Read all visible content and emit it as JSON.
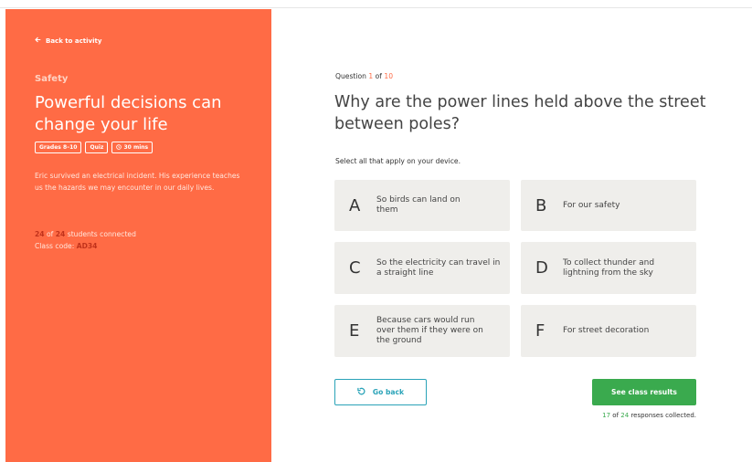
{
  "sidebar": {
    "back_label": "Back to activity",
    "category": "Safety",
    "title": "Powerful decisions can change your life",
    "tags": [
      "Grades 8–10",
      "Quiz",
      "30 mins"
    ],
    "description": "Eric survived an electrical incident. His experience teaches us the hazards we may encounter in our daily lives.",
    "connected_count": "24",
    "connected_of": "of",
    "connected_total": "24",
    "connected_suffix": "students connected",
    "class_code_label": "Class code:",
    "class_code": "AD34"
  },
  "question": {
    "prefix": "Question",
    "number": "1",
    "of": "of",
    "total": "10",
    "text": "Why are the power lines held above the street between poles?",
    "instruction": "Select all that apply on your device.",
    "options": [
      {
        "letter": "A",
        "text": "So birds can land on them"
      },
      {
        "letter": "B",
        "text": "For our safety"
      },
      {
        "letter": "C",
        "text": "So the electricity can travel in a straight line"
      },
      {
        "letter": "D",
        "text": "To collect thunder and lightning from the sky"
      },
      {
        "letter": "E",
        "text": "Because cars would run over them if they were on the ground"
      },
      {
        "letter": "F",
        "text": "For street decoration"
      }
    ]
  },
  "actions": {
    "go_back_label": "Go back",
    "results_label": "See class results",
    "responses_count": "17",
    "responses_of": "of",
    "responses_total": "24",
    "responses_suffix": "responses collected."
  },
  "colors": {
    "accent_orange": "#ff6b45",
    "teal": "#2aa3b8",
    "green": "#3aaa4e",
    "option_bg": "#efeeeb"
  },
  "icons": {
    "back": "arrow-left-icon",
    "clock": "clock-icon",
    "go_back": "undo-icon"
  }
}
